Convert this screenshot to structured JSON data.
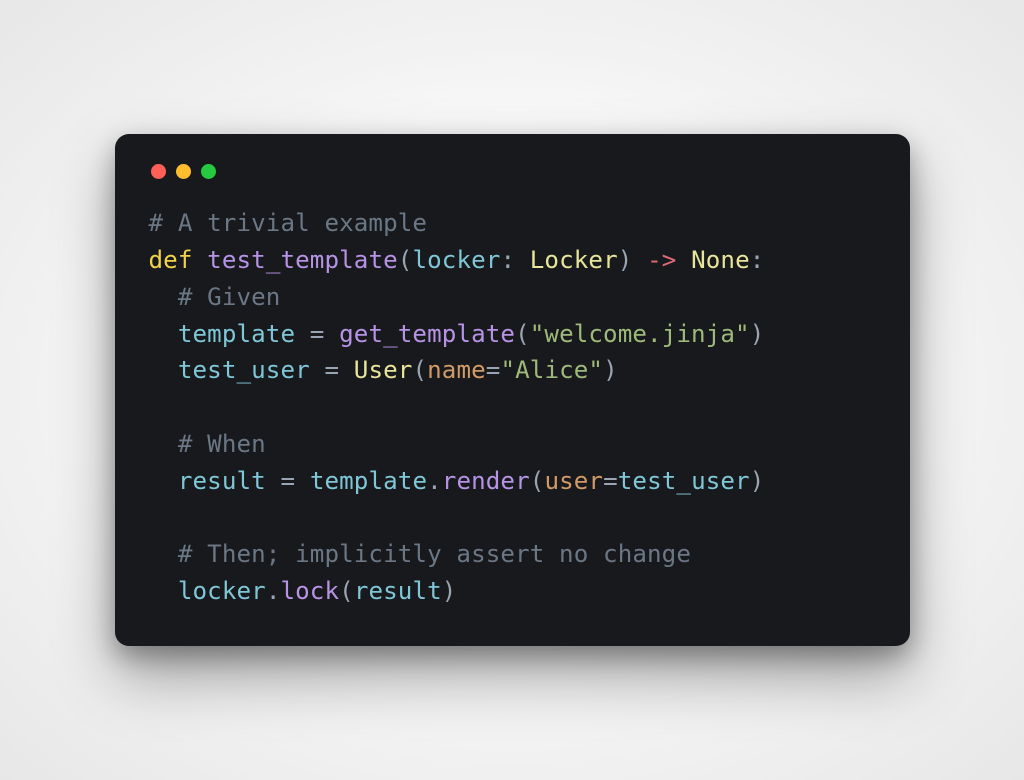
{
  "window": {
    "traffic_lights": [
      "close",
      "minimize",
      "zoom"
    ]
  },
  "code": {
    "indent": "  ",
    "lines": [
      {
        "n": 1,
        "tokens": [
          {
            "cls": "c",
            "t": "# A trivial example"
          }
        ]
      },
      {
        "n": 2,
        "tokens": [
          {
            "cls": "kw",
            "t": "def"
          },
          {
            "cls": "op",
            "t": " "
          },
          {
            "cls": "fn",
            "t": "test_template"
          },
          {
            "cls": "op",
            "t": "("
          },
          {
            "cls": "id",
            "t": "locker"
          },
          {
            "cls": "op",
            "t": ": "
          },
          {
            "cls": "ty",
            "t": "Locker"
          },
          {
            "cls": "op",
            "t": ") "
          },
          {
            "cls": "ar",
            "t": "->"
          },
          {
            "cls": "op",
            "t": " "
          },
          {
            "cls": "ty",
            "t": "None"
          },
          {
            "cls": "op",
            "t": ":"
          }
        ]
      },
      {
        "n": 3,
        "indent": 1,
        "tokens": [
          {
            "cls": "c",
            "t": "# Given"
          }
        ]
      },
      {
        "n": 4,
        "indent": 1,
        "tokens": [
          {
            "cls": "id",
            "t": "template"
          },
          {
            "cls": "op",
            "t": " = "
          },
          {
            "cls": "fn",
            "t": "get_template"
          },
          {
            "cls": "op",
            "t": "("
          },
          {
            "cls": "st",
            "t": "\"welcome.jinja\""
          },
          {
            "cls": "op",
            "t": ")"
          }
        ]
      },
      {
        "n": 5,
        "indent": 1,
        "tokens": [
          {
            "cls": "id",
            "t": "test_user"
          },
          {
            "cls": "op",
            "t": " = "
          },
          {
            "cls": "ty",
            "t": "User"
          },
          {
            "cls": "op",
            "t": "("
          },
          {
            "cls": "kv",
            "t": "name"
          },
          {
            "cls": "op",
            "t": "="
          },
          {
            "cls": "st",
            "t": "\"Alice\""
          },
          {
            "cls": "op",
            "t": ")"
          }
        ]
      },
      {
        "n": 6,
        "blank": true
      },
      {
        "n": 7,
        "indent": 1,
        "tokens": [
          {
            "cls": "c",
            "t": "# When"
          }
        ]
      },
      {
        "n": 8,
        "indent": 1,
        "tokens": [
          {
            "cls": "id",
            "t": "result"
          },
          {
            "cls": "op",
            "t": " = "
          },
          {
            "cls": "id",
            "t": "template"
          },
          {
            "cls": "op",
            "t": "."
          },
          {
            "cls": "fn",
            "t": "render"
          },
          {
            "cls": "op",
            "t": "("
          },
          {
            "cls": "kv",
            "t": "user"
          },
          {
            "cls": "op",
            "t": "="
          },
          {
            "cls": "id",
            "t": "test_user"
          },
          {
            "cls": "op",
            "t": ")"
          }
        ]
      },
      {
        "n": 9,
        "blank": true
      },
      {
        "n": 10,
        "indent": 1,
        "tokens": [
          {
            "cls": "c",
            "t": "# Then; implicitly assert no change"
          }
        ]
      },
      {
        "n": 11,
        "indent": 1,
        "tokens": [
          {
            "cls": "id",
            "t": "locker"
          },
          {
            "cls": "op",
            "t": "."
          },
          {
            "cls": "fn",
            "t": "lock"
          },
          {
            "cls": "op",
            "t": "("
          },
          {
            "cls": "id",
            "t": "result"
          },
          {
            "cls": "op",
            "t": ")"
          }
        ]
      }
    ]
  }
}
